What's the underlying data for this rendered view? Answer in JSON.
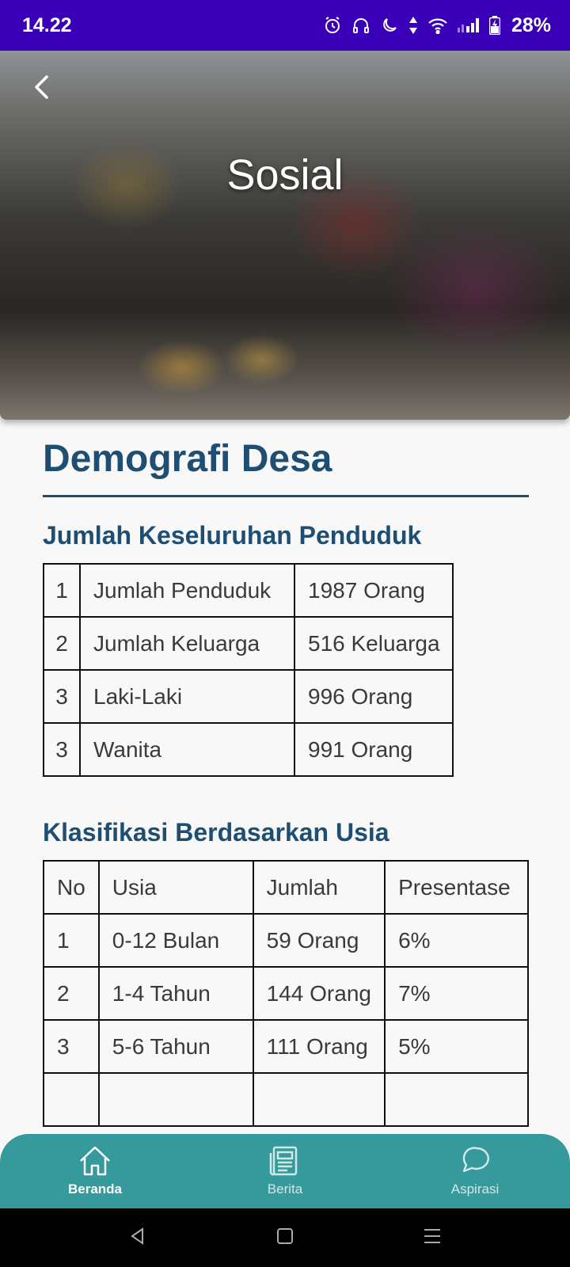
{
  "status_bar": {
    "time": "14.22",
    "battery": "28%",
    "icons": [
      "alarm-icon",
      "headphones-icon",
      "moon-icon",
      "data-arrows-icon",
      "wifi-icon",
      "signal-icon",
      "battery-icon"
    ]
  },
  "hero": {
    "title": "Sosial",
    "back_icon": "chevron-left-icon"
  },
  "page": {
    "heading": "Demografi Desa"
  },
  "population_section": {
    "title": "Jumlah Keseluruhan Penduduk",
    "rows": [
      {
        "no": "1",
        "label": "Jumlah Penduduk",
        "value": "1987 Orang"
      },
      {
        "no": "2",
        "label": "Jumlah Keluarga",
        "value": "516 Keluarga"
      },
      {
        "no": "3",
        "label": "Laki-Laki",
        "value": "996 Orang"
      },
      {
        "no": "3",
        "label": "Wanita",
        "value": "991 Orang"
      }
    ]
  },
  "age_section": {
    "title": "Klasifikasi Berdasarkan Usia",
    "headers": [
      "No",
      "Usia",
      "Jumlah",
      "Presentase"
    ],
    "rows": [
      {
        "no": "1",
        "age": "0-12 Bulan",
        "count": "59 Orang",
        "percent": "6%"
      },
      {
        "no": "2",
        "age": "1-4 Tahun",
        "count": "144 Orang",
        "percent": "7%"
      },
      {
        "no": "3",
        "age": "5-6 Tahun",
        "count": "111 Orang",
        "percent": "5%"
      }
    ]
  },
  "bottom_nav": {
    "items": [
      {
        "label": "Beranda",
        "icon": "home-icon",
        "active": true
      },
      {
        "label": "Berita",
        "icon": "newspaper-icon",
        "active": false
      },
      {
        "label": "Aspirasi",
        "icon": "chat-bubble-icon",
        "active": false
      }
    ]
  },
  "colors": {
    "status_bar": "#3a00b7",
    "heading": "#1f4e73",
    "bottom_nav": "#36999b"
  }
}
